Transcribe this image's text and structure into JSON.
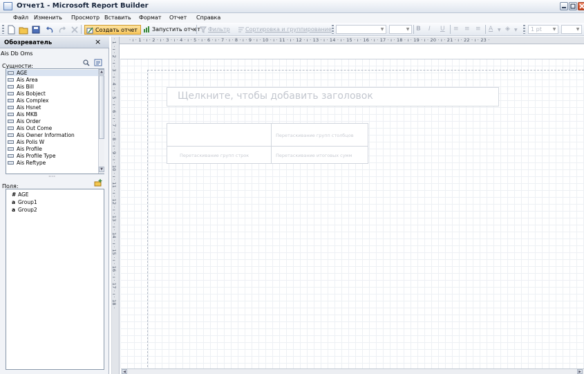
{
  "window": {
    "title": "Отчет1 - Microsoft Report Builder"
  },
  "menu": [
    "Файл",
    "Изменить",
    "Просмотр",
    "Вставить",
    "Формат",
    "Отчет",
    "Справка"
  ],
  "toolbar": {
    "design_report": "Создать отчет",
    "run_report": "Запустить отчет",
    "filter": "Фильтр",
    "sort_group": "Сортировка и группирование",
    "font_size": "1 pt"
  },
  "explorer": {
    "header": "Обозреватель",
    "close_glyph": "×",
    "model": "Ais Db Oms",
    "entities_label": "Сущности:",
    "entities": [
      "AGE",
      "Ais Area",
      "Ais Bill",
      "Ais Bobject",
      "Ais Complex",
      "Ais Hsnet",
      "Ais MKB",
      "Ais Order",
      "Ais Out Come",
      "Ais Owner Information",
      "Ais Polis W",
      "Ais Profile",
      "Ais Profile Type",
      "Ais Reftype"
    ],
    "selected_entity": "AGE",
    "splitter_dots": "····",
    "fields_label": "Поля:",
    "fields": [
      {
        "type": "#",
        "name": "AGE"
      },
      {
        "type": "a",
        "name": "Group1"
      },
      {
        "type": "a",
        "name": "Group2"
      }
    ]
  },
  "ruler": {
    "horizontal": "· ı · 1 · ı · 2 · ı · 3 · ı · 4 · ı · 5 · ı · 6 · ı · 7 · ı · 8 · ı · 9 · ı · 10 · ı · 11 · ı · 12 · ı · 13 · ı · 14 · ı · 15 · ı · 16 · ı · 17 · ı · 18 · ı · 19 · ı · 20 · ı · 21 · ı · 22 · ı · 23 ·",
    "vertical": "· 1 · ı · 2 · ı · 3 · ı · 4 · ı · 5 · ı · 6 · ı · 7 · ı · 8 · ı · 9 · ı · 10 · ı · 11 · ı · 12 · ı · 13 · ı · 14 · ı · 15 · ı · 16 · ı · 17 · ı · 18 ·"
  },
  "report": {
    "title_placeholder": "Щелкните, чтобы добавить заголовок",
    "matrix": {
      "column_groups": "Перетаскивание групп столбцов",
      "row_groups": "Перетаскивание групп строк",
      "totals": "Перетаскивание итоговых сумм"
    }
  },
  "colors": {
    "accent": "#f7c55a",
    "selection": "#d9e3f1",
    "chrome": "#e2e5ea"
  }
}
